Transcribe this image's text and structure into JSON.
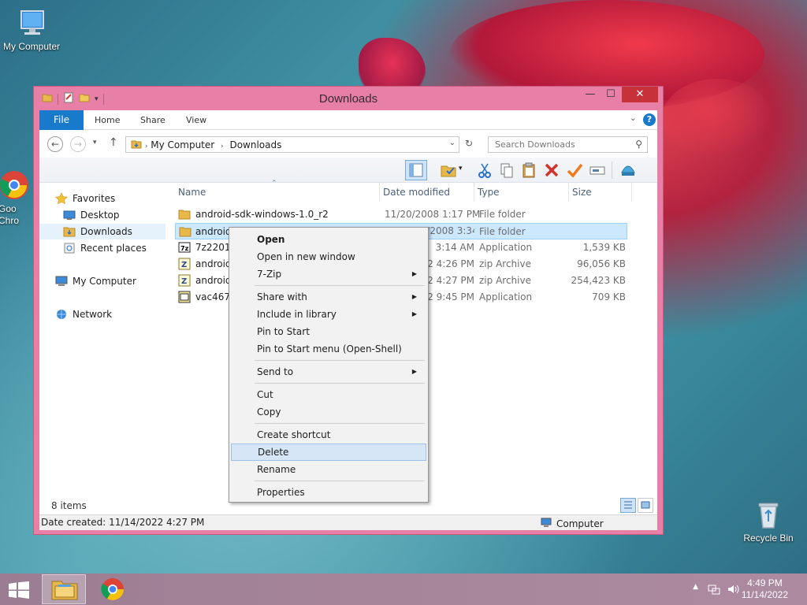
{
  "desktop": {
    "icons": [
      {
        "label": "My Computer"
      },
      {
        "label_line1": "Goo",
        "label_line2": "Chro"
      },
      {
        "label": "Recycle Bin"
      }
    ]
  },
  "window": {
    "title": "Downloads",
    "ribbon_tabs": {
      "file": "File",
      "home": "Home",
      "share": "Share",
      "view": "View"
    },
    "help": "?",
    "address": {
      "segment1": "My Computer",
      "segment2": "Downloads"
    },
    "search": {
      "placeholder": "Search Downloads"
    },
    "nav_pane": {
      "favorites": "Favorites",
      "desktop": "Desktop",
      "downloads": "Downloads",
      "recent": "Recent places",
      "computer": "My Computer",
      "network": "Network"
    },
    "columns": {
      "name": "Name",
      "date": "Date modified",
      "type": "Type",
      "size": "Size"
    },
    "files": [
      {
        "name": "android-sdk-windows-1.0_r2",
        "date": "11/20/2008 1:17 PM",
        "type": "File folder",
        "size": ""
      },
      {
        "name": "android-",
        "date": "",
        "date_tail": "2/6/2008 3:34 PM",
        "type": "File folder",
        "size": ""
      },
      {
        "name": "7z2201-x",
        "date_tail": "3:14 AM",
        "type": "Application",
        "size": "1,539 KB"
      },
      {
        "name": "android-",
        "date_tail": "2 4:26 PM",
        "type": "zip Archive",
        "size": "96,056 KB"
      },
      {
        "name": "android-",
        "date_tail": "2 4:27 PM",
        "type": "zip Archive",
        "size": "254,423 KB"
      },
      {
        "name": "vac467",
        "date_tail": "2 9:45 PM",
        "type": "Application",
        "size": "709 KB"
      }
    ],
    "status": {
      "items": "8 items",
      "details": "Date created: 11/14/2022 4:27 PM",
      "location": "Computer"
    }
  },
  "context_menu": {
    "open": "Open",
    "open_new_window": "Open in new window",
    "seven_zip": "7-Zip",
    "share_with": "Share with",
    "include_library": "Include in library",
    "pin_start": "Pin to Start",
    "pin_start_menu": "Pin to Start menu (Open-Shell)",
    "send_to": "Send to",
    "cut": "Cut",
    "copy": "Copy",
    "create_shortcut": "Create shortcut",
    "delete": "Delete",
    "rename": "Rename",
    "properties": "Properties"
  },
  "taskbar": {
    "time": "4:49 PM",
    "date": "11/14/2022"
  },
  "colors": {
    "accent": "#1979ca",
    "window_frame": "#e77fa7",
    "close": "#c7313a",
    "selection": "#cce8ff"
  }
}
